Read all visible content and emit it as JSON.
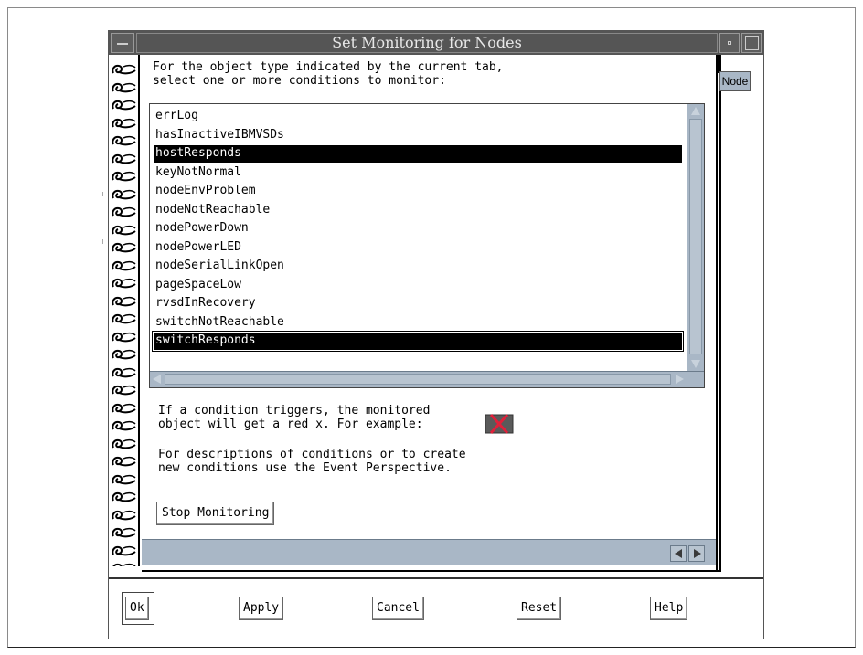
{
  "window": {
    "title": "Set Monitoring for Nodes"
  },
  "instructions": {
    "line1": "For the object type indicated by the current tab,",
    "line2": "select one or more conditions to monitor:"
  },
  "conditions": [
    {
      "label": "errLog",
      "selected": false
    },
    {
      "label": "hasInactiveIBMVSDs",
      "selected": false
    },
    {
      "label": "hostResponds",
      "selected": true
    },
    {
      "label": "keyNotNormal",
      "selected": false
    },
    {
      "label": "nodeEnvProblem",
      "selected": false
    },
    {
      "label": "nodeNotReachable",
      "selected": false
    },
    {
      "label": "nodePowerDown",
      "selected": false
    },
    {
      "label": "nodePowerLED",
      "selected": false
    },
    {
      "label": "nodeSerialLinkOpen",
      "selected": false
    },
    {
      "label": "pageSpaceLow",
      "selected": false
    },
    {
      "label": "rvsdInRecovery",
      "selected": false
    },
    {
      "label": "switchNotReachable",
      "selected": false
    },
    {
      "label": "switchResponds",
      "selected": true
    }
  ],
  "trigger_note": {
    "line1": "If a condition triggers, the monitored",
    "line2": "object will get a red x. For example:"
  },
  "description_note": {
    "line1": "For descriptions of conditions or to create",
    "line2": "new conditions use the Event Perspective."
  },
  "stop_monitoring_label": "Stop Monitoring",
  "tab_label": "Node",
  "buttons": {
    "ok": "Ok",
    "apply": "Apply",
    "cancel": "Cancel",
    "reset": "Reset",
    "help": "Help"
  },
  "colors": {
    "scroll_bg": "#a9b7c6",
    "title_bg": "#555555",
    "selection_bg": "#000000",
    "error_x": "#e0203a"
  }
}
